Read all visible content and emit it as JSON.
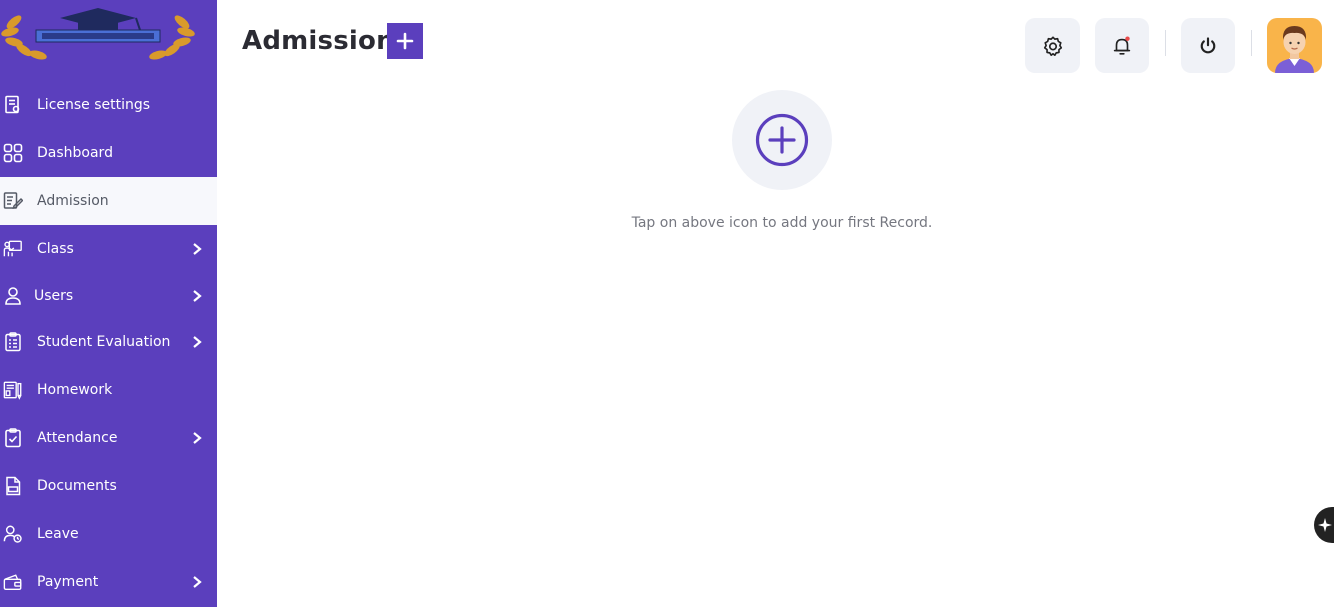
{
  "header": {
    "title": "Admission"
  },
  "sidebar": {
    "items": [
      {
        "label": "License settings",
        "icon": "license-icon",
        "active": false,
        "has_submenu": false
      },
      {
        "label": "Dashboard",
        "icon": "grid-icon",
        "active": false,
        "has_submenu": false
      },
      {
        "label": "Admission",
        "icon": "admission-form-icon",
        "active": true,
        "has_submenu": false
      },
      {
        "label": "Class",
        "icon": "classroom-icon",
        "active": false,
        "has_submenu": true
      },
      {
        "label": "Users",
        "icon": "user-icon",
        "active": false,
        "has_submenu": true
      },
      {
        "label": "Student Evaluation",
        "icon": "evaluation-clipboard-icon",
        "active": false,
        "has_submenu": true
      },
      {
        "label": "Homework",
        "icon": "homework-icon",
        "active": false,
        "has_submenu": false
      },
      {
        "label": "Attendance",
        "icon": "attendance-check-icon",
        "active": false,
        "has_submenu": true
      },
      {
        "label": "Documents",
        "icon": "document-icon",
        "active": false,
        "has_submenu": false
      },
      {
        "label": "Leave",
        "icon": "leave-icon",
        "active": false,
        "has_submenu": false
      },
      {
        "label": "Payment",
        "icon": "wallet-icon",
        "active": false,
        "has_submenu": true
      }
    ]
  },
  "empty_state": {
    "message": "Tap on above icon to add your first Record."
  },
  "colors": {
    "sidebar_bg": "#5b3fbd",
    "accent": "#5b3fbd",
    "active_item_bg": "#f7f8fc",
    "header_button_bg": "#f0f2f7",
    "notification_dot": "#e94b4b",
    "avatar_bg": "#f9b44a"
  }
}
